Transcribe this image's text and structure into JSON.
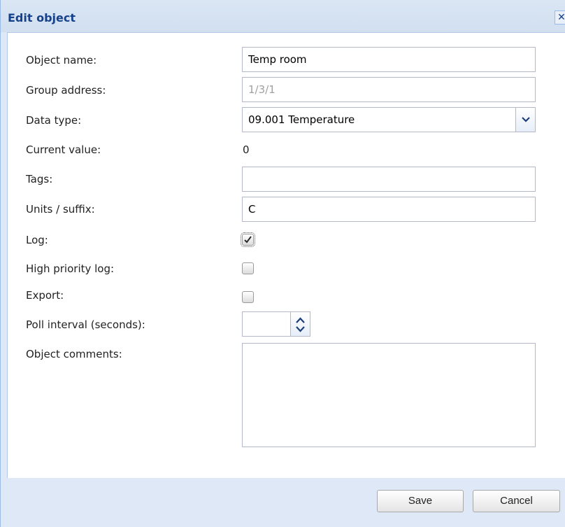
{
  "window": {
    "title": "Edit object",
    "close_icon": "close-icon"
  },
  "form": {
    "object_name": {
      "label": "Object name:",
      "value": "Temp room"
    },
    "group_address": {
      "label": "Group address:",
      "value": "1/3/1"
    },
    "data_type": {
      "label": "Data type:",
      "value": "09.001 Temperature",
      "icon": "chevron-down-icon"
    },
    "current_value": {
      "label": "Current value:",
      "value": "0"
    },
    "tags": {
      "label": "Tags:",
      "value": ""
    },
    "units_suffix": {
      "label": "Units / suffix:",
      "value": "C"
    },
    "log": {
      "label": "Log:",
      "checked": true
    },
    "high_priority_log": {
      "label": "High priority log:",
      "checked": false
    },
    "export": {
      "label": "Export:",
      "checked": false
    },
    "poll_interval": {
      "label": "Poll interval (seconds):",
      "value": "",
      "icons": [
        "chevron-up-icon",
        "chevron-down-icon"
      ]
    },
    "object_comments": {
      "label": "Object comments:",
      "value": ""
    }
  },
  "footer": {
    "save_label": "Save",
    "cancel_label": "Cancel"
  },
  "colors": {
    "title": "#15428b",
    "frame": "#dfe8f6",
    "border": "#99bbe8",
    "checkmark": "#2a2a2a"
  }
}
